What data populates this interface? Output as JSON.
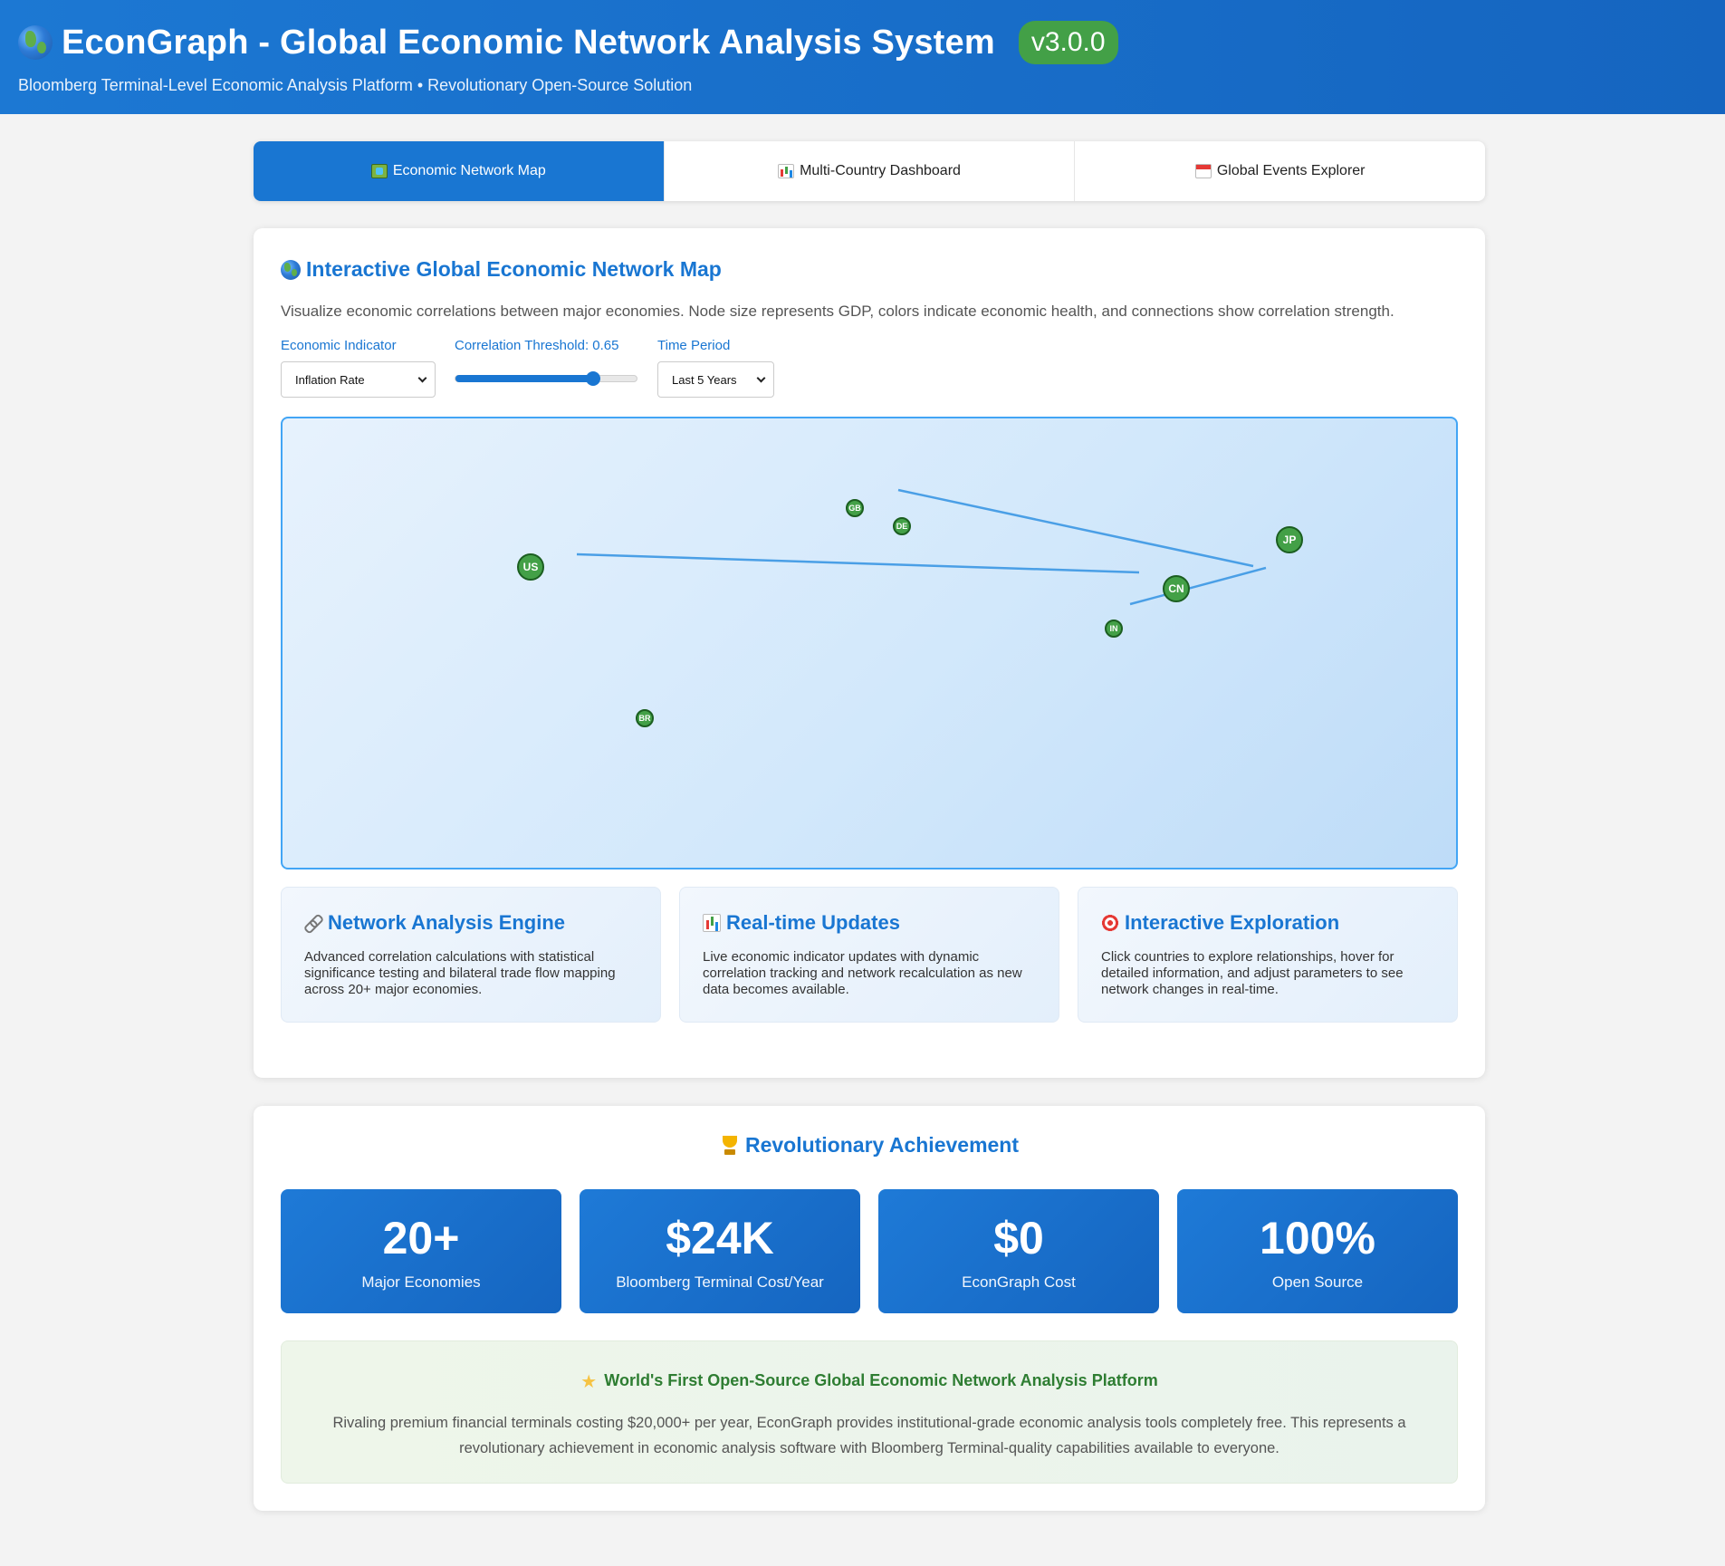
{
  "header": {
    "title": "EconGraph - Global Economic Network Analysis System",
    "version": "v3.0.0",
    "subtitle": "Bloomberg Terminal-Level Economic Analysis Platform • Revolutionary Open-Source Solution"
  },
  "tabs": [
    {
      "label": "Economic Network Map",
      "icon": "map-icon",
      "active": true
    },
    {
      "label": "Multi-Country Dashboard",
      "icon": "bar-chart-icon",
      "active": false
    },
    {
      "label": "Global Events Explorer",
      "icon": "calendar-icon",
      "active": false
    }
  ],
  "network": {
    "title": "Interactive Global Economic Network Map",
    "description": "Visualize economic correlations between major economies. Node size represents GDP, colors indicate economic health, and connections show correlation strength.",
    "controls": {
      "indicator_label": "Economic Indicator",
      "indicator_value": "Inflation Rate",
      "threshold_label": "Correlation Threshold: 0.65",
      "threshold_value": 0.65,
      "period_label": "Time Period",
      "period_value": "Last 5 Years"
    },
    "colors": {
      "node_fill": "#43a047",
      "node_stroke": "#1b5e20",
      "link": "#4a9fe6"
    },
    "countries": [
      {
        "code": "US"
      },
      {
        "code": "GB"
      },
      {
        "code": "DE"
      },
      {
        "code": "JP"
      },
      {
        "code": "CN"
      },
      {
        "code": "IN"
      },
      {
        "code": "BR"
      }
    ]
  },
  "features": [
    {
      "icon": "link-icon",
      "title": "Network Analysis Engine",
      "text": "Advanced correlation calculations with statistical significance testing and bilateral trade flow mapping across 20+ major economies."
    },
    {
      "icon": "bar-chart-icon",
      "title": "Real-time Updates",
      "text": "Live economic indicator updates with dynamic correlation tracking and network recalculation as new data becomes available."
    },
    {
      "icon": "target-icon",
      "title": "Interactive Exploration",
      "text": "Click countries to explore relationships, hover for detailed information, and adjust parameters to see network changes in real-time."
    }
  ],
  "achievement": {
    "title": "Revolutionary Achievement",
    "stats": [
      {
        "value": "20+",
        "label": "Major Economies"
      },
      {
        "value": "$24K",
        "label": "Bloomberg Terminal Cost/Year"
      },
      {
        "value": "$0",
        "label": "EconGraph Cost"
      },
      {
        "value": "100%",
        "label": "Open Source"
      }
    ],
    "banner_title": "World's First Open-Source Global Economic Network Analysis Platform",
    "banner_text": "Rivaling premium financial terminals costing $20,000+ per year, EconGraph provides institutional-grade economic analysis tools completely free. This represents a revolutionary achievement in economic analysis software with Bloomberg Terminal-quality capabilities available to everyone."
  }
}
